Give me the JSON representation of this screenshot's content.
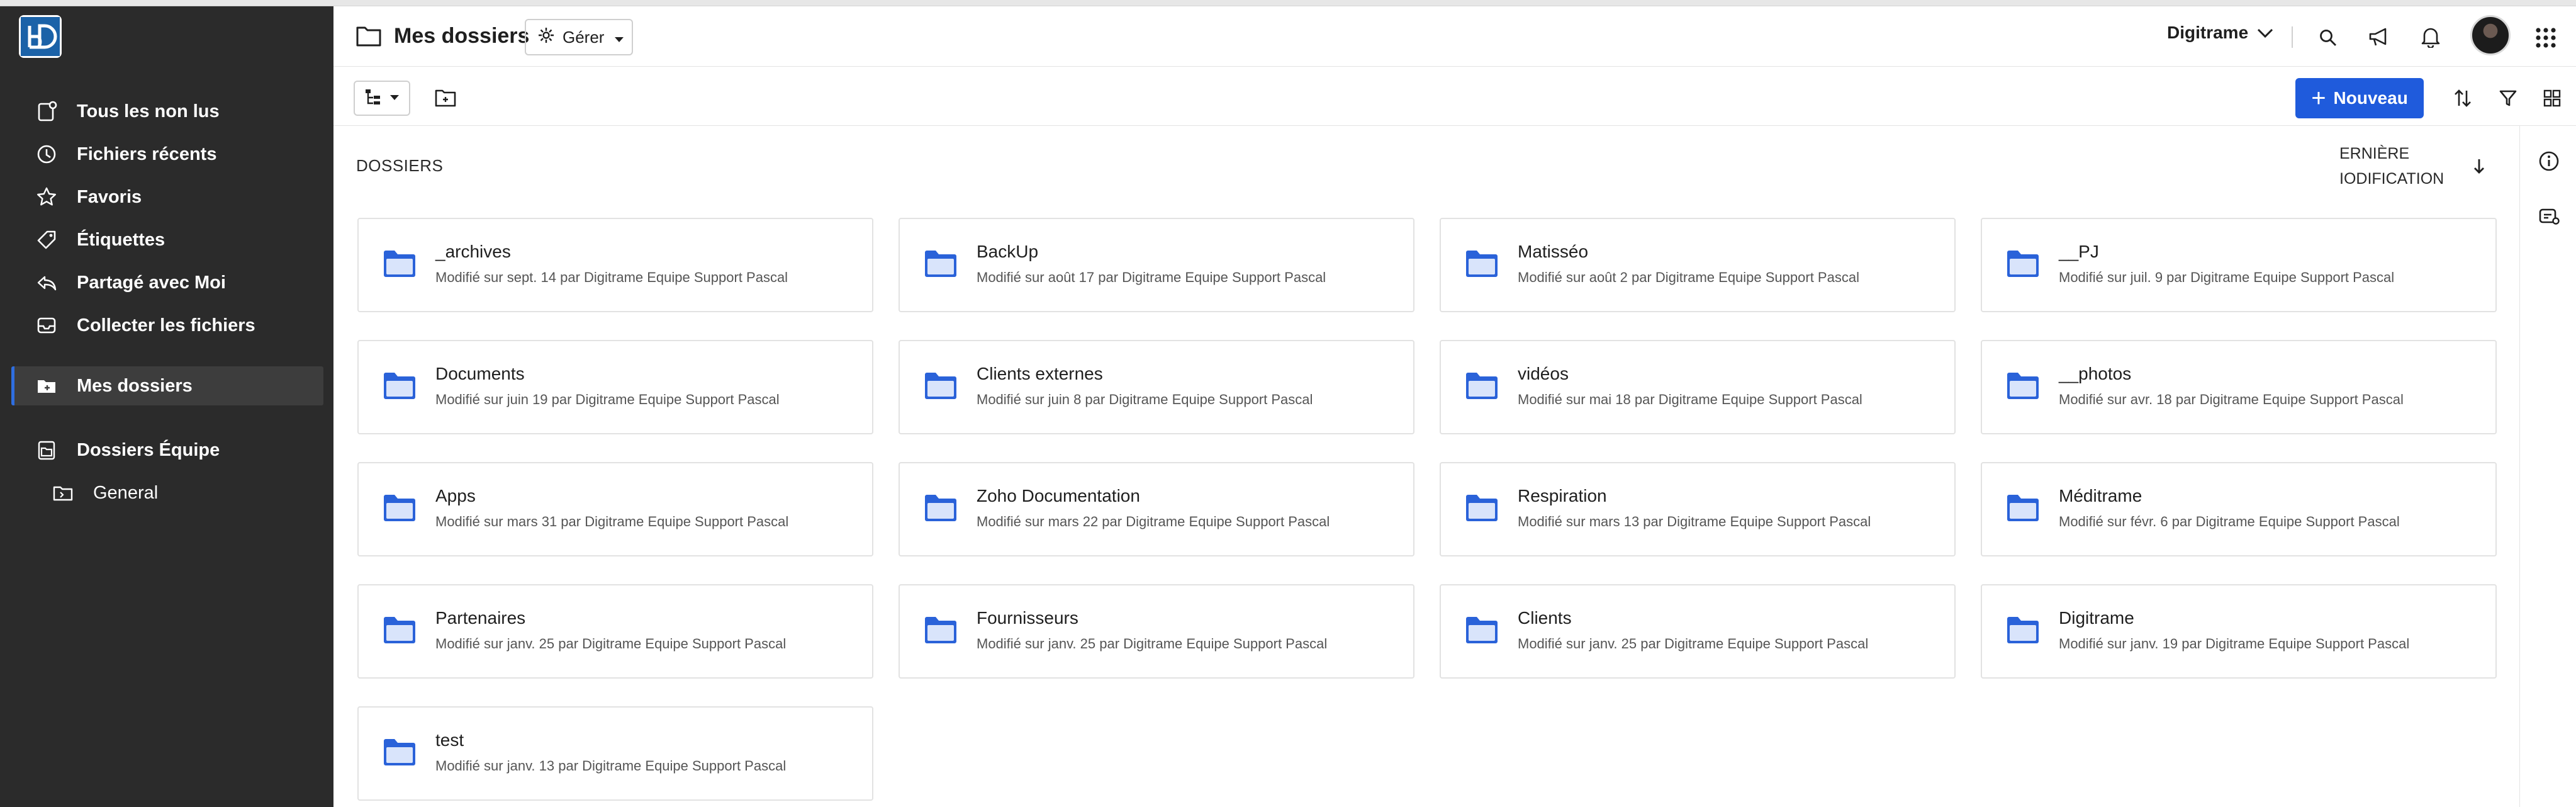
{
  "sidebar": {
    "items": [
      {
        "label": "Tous les non lus",
        "icon": "unread-doc-icon"
      },
      {
        "label": "Fichiers récents",
        "icon": "clock-icon"
      },
      {
        "label": "Favoris",
        "icon": "star-icon"
      },
      {
        "label": "Étiquettes",
        "icon": "tag-icon"
      },
      {
        "label": "Partagé avec Moi",
        "icon": "share-icon"
      },
      {
        "label": "Collecter les fichiers",
        "icon": "inbox-icon"
      },
      {
        "label": "Mes dossiers",
        "icon": "folder-icon",
        "active": true
      },
      {
        "label": "Dossiers Équipe",
        "icon": "team-folder-icon"
      },
      {
        "label": "General",
        "icon": "subfolder-icon"
      }
    ]
  },
  "header": {
    "title": "Mes dossiers",
    "manage_label": "Gérer",
    "org_name": "Digitrame"
  },
  "toolbar": {
    "new_label": "Nouveau"
  },
  "content": {
    "section_label": "DOSSIERS",
    "sort_label_line1": "ERNIÈRE",
    "sort_label_line2": "IODIFICATION"
  },
  "folders": [
    {
      "name": "_archives",
      "meta": "Modifié sur sept. 14 par Digitrame Equipe Support Pascal"
    },
    {
      "name": "BackUp",
      "meta": "Modifié sur août 17 par Digitrame Equipe Support Pascal"
    },
    {
      "name": "Matisséo",
      "meta": "Modifié sur août 2 par Digitrame Equipe Support Pascal"
    },
    {
      "name": "__PJ",
      "meta": "Modifié sur juil. 9 par Digitrame Equipe Support Pascal"
    },
    {
      "name": "Documents",
      "meta": "Modifié sur juin 19 par Digitrame Equipe Support Pascal"
    },
    {
      "name": "Clients externes",
      "meta": "Modifié sur juin 8 par Digitrame Equipe Support Pascal"
    },
    {
      "name": "vidéos",
      "meta": "Modifié sur mai 18 par Digitrame Equipe Support Pascal"
    },
    {
      "name": "__photos",
      "meta": "Modifié sur avr. 18 par Digitrame Equipe Support Pascal"
    },
    {
      "name": "Apps",
      "meta": "Modifié sur mars 31 par Digitrame Equipe Support Pascal"
    },
    {
      "name": "Zoho Documentation",
      "meta": "Modifié sur mars 22 par Digitrame Equipe Support Pascal"
    },
    {
      "name": "Respiration",
      "meta": "Modifié sur mars 13 par Digitrame Equipe Support Pascal"
    },
    {
      "name": "Méditrame",
      "meta": "Modifié sur févr. 6 par Digitrame Equipe Support Pascal"
    },
    {
      "name": "Partenaires",
      "meta": "Modifié sur janv. 25 par Digitrame Equipe Support Pascal"
    },
    {
      "name": "Fournisseurs",
      "meta": "Modifié sur janv. 25 par Digitrame Equipe Support Pascal"
    },
    {
      "name": "Clients",
      "meta": "Modifié sur janv. 25 par Digitrame Equipe Support Pascal"
    },
    {
      "name": "Digitrame",
      "meta": "Modifié sur janv. 19 par Digitrame Equipe Support Pascal"
    },
    {
      "name": "test",
      "meta": "Modifié sur janv. 13 par Digitrame Equipe Support Pascal"
    }
  ],
  "colors": {
    "sidebar_bg": "#2b2b2b",
    "accent": "#1f5bdc",
    "folder_icon": "#2a62d9"
  }
}
